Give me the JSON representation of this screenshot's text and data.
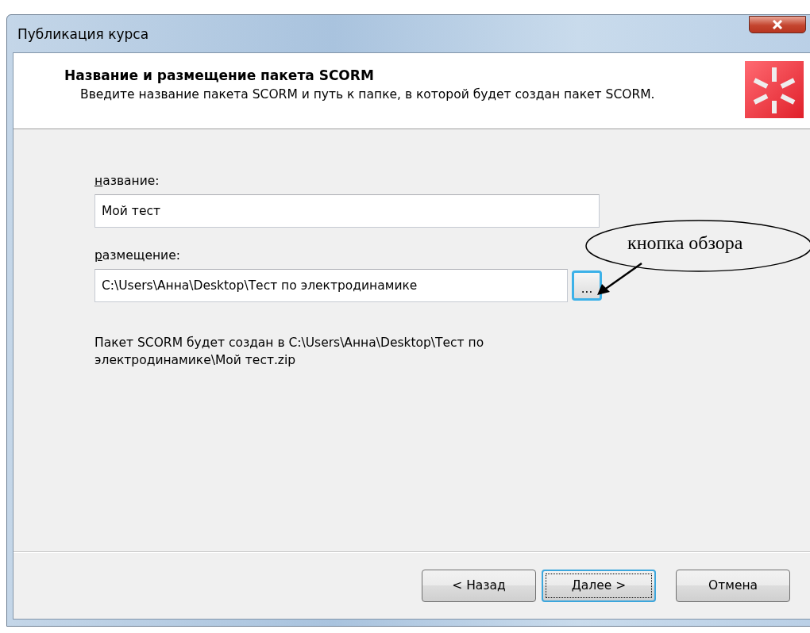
{
  "window": {
    "title": "Публикация курса"
  },
  "header": {
    "title": "Название и размещение пакета SCORM",
    "subtitle": "Введите название пакета SCORM и путь к папке, в которой будет создан пакет SCORM."
  },
  "fields": [
    {
      "label": "название:",
      "value": "Мой тест",
      "kind": "text"
    },
    {
      "label": "размещение:",
      "value": "C:\\Users\\Анна\\Desktop\\Тест по электродинамике",
      "kind": "browse",
      "browse_label": "...",
      "focused": true
    }
  ],
  "info": "Пакет SCORM будет создан в C:\\Users\\Анна\\Desktop\\Тест по электродинамике\\Мой тест.zip",
  "buttons": [
    {
      "label": "< Назад",
      "default": false
    },
    {
      "label": "Далее >",
      "default": true
    },
    {
      "label": "Отмена",
      "default": false
    }
  ],
  "callout": {
    "text": "кнопка обзора"
  }
}
